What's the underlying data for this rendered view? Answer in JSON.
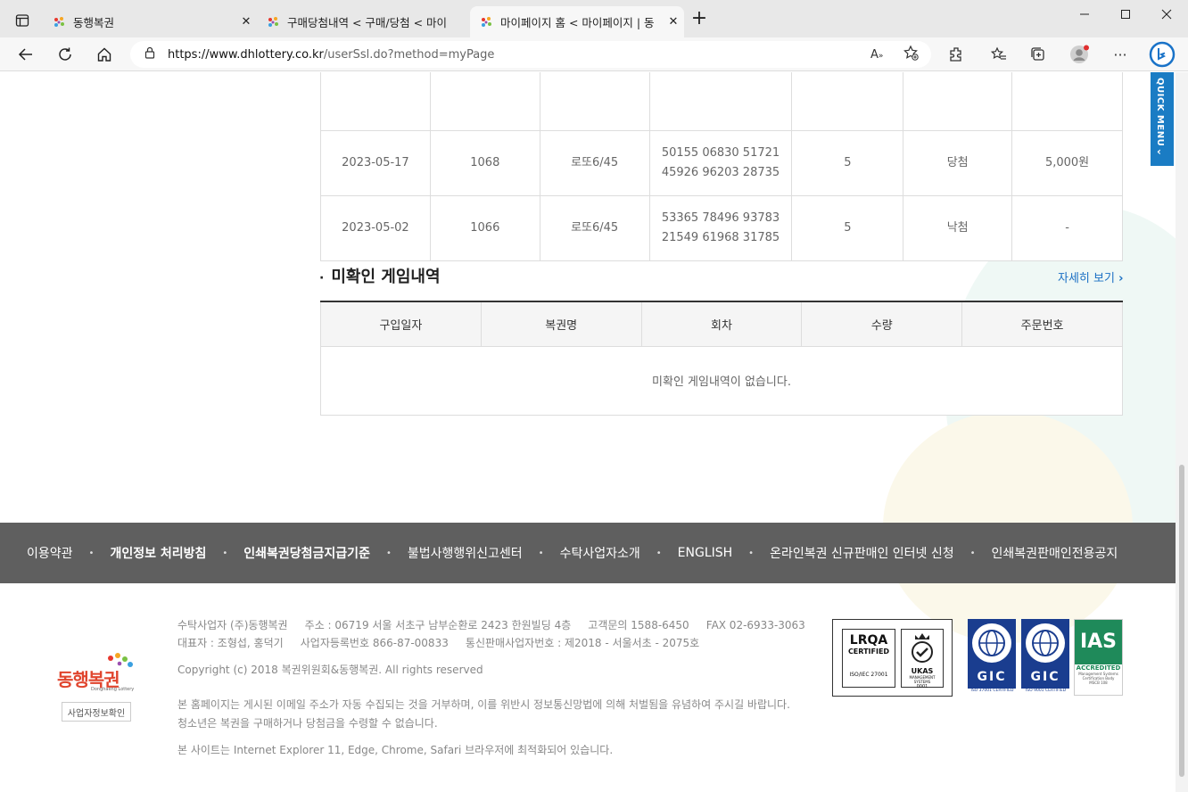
{
  "browser": {
    "tabs": [
      {
        "title": "동행복권",
        "close": "✕"
      },
      {
        "title": "구매당첨내역 < 구매/당첨 < 마이",
        "close": "✕"
      },
      {
        "title": "마이페이지 홈 < 마이페이지 | 동",
        "close": "✕"
      }
    ],
    "new_tab": "+",
    "url_host": "https://www.dhlottery.co.kr",
    "url_path": "/userSsl.do?method=myPage"
  },
  "quick_menu": {
    "label": "QUICK MENU",
    "arrow": "‹"
  },
  "winning_rows": [
    {
      "date": "2023-05-17",
      "round": "1068",
      "game": "로또6/45",
      "numbers1": "50155 06830 51721",
      "numbers2": "45926 96203 28735",
      "qty": "5",
      "result": "당첨",
      "amount": "5,000원"
    },
    {
      "date": "2023-05-02",
      "round": "1066",
      "game": "로또6/45",
      "numbers1": "53365 78496 93783",
      "numbers2": "21549 61968 31785",
      "qty": "5",
      "result": "낙첨",
      "amount": "-"
    }
  ],
  "unconfirmed": {
    "dot": "·",
    "title": "미확인 게임내역",
    "more": "자세히 보기",
    "more_arrow": "›",
    "headers": [
      "구입일자",
      "복권명",
      "회차",
      "수량",
      "주문번호"
    ],
    "empty_message": "미확인 게임내역이 없습니다."
  },
  "footer_nav": {
    "separator": "•",
    "items": [
      "이용약관",
      "개인정보 처리방침",
      "인쇄복권당첨금지급기준",
      "불법사행행위신고센터",
      "수탁사업자소개",
      "ENGLISH",
      "온라인복권 신규판매인 인터넷 신청",
      "인쇄복권판매인전용공지"
    ]
  },
  "footer": {
    "logo_text": "동행복권",
    "logo_sub": "Donghaeng Lottery",
    "privacy_btn": "사업자정보확인",
    "line1": "수탁사업자 (주)동행복권     주소 : 06719 서울 서초구 남부순환로 2423 한원빌딩 4층     고객문의 1588-6450     FAX 02-6933-3063",
    "line2": "대표자 : 조형섭, 홍덕기     사업자등록번호 866-87-00833     통신판매사업자번호 : 제2018 - 서울서초 - 2075호",
    "copyright": "Copyright (c) 2018 복권위원회&동행복권. All rights reserved",
    "notice1": "본 홈페이지는 게시된 이메일 주소가 자동 수집되는 것을 거부하며, 이를 위반시 정보통신망법에 의해 처벌됨을 유념하여 주시길 바랍니다.",
    "notice2": "청소년은 복권을 구매하거나 당첨금을 수령할 수 없습니다.",
    "notice3": "본 사이트는 Internet Explorer 11, Edge, Chrome, Safari 브라우저에 최적화되어 있습니다."
  },
  "certs": {
    "lrqa": "LRQA",
    "lrqa_certified": "CERTIFIED",
    "lrqa_iso": "ISO/IEC 27001",
    "ukas": "UKAS",
    "ukas_sub": "MANAGEMENT SYSTEMS",
    "ukas_num": "0001",
    "gic": "GIC",
    "gic1_caption": "ISO 37001 CERTIFIED",
    "gic2_caption": "ISO 9001 CERTIFIED",
    "ias": "IAS",
    "ias_acc": "ACCREDITED",
    "ias_sub1": "Management Systems",
    "ias_sub2": "Certification Body",
    "ias_sub3": "MSCB 108"
  }
}
